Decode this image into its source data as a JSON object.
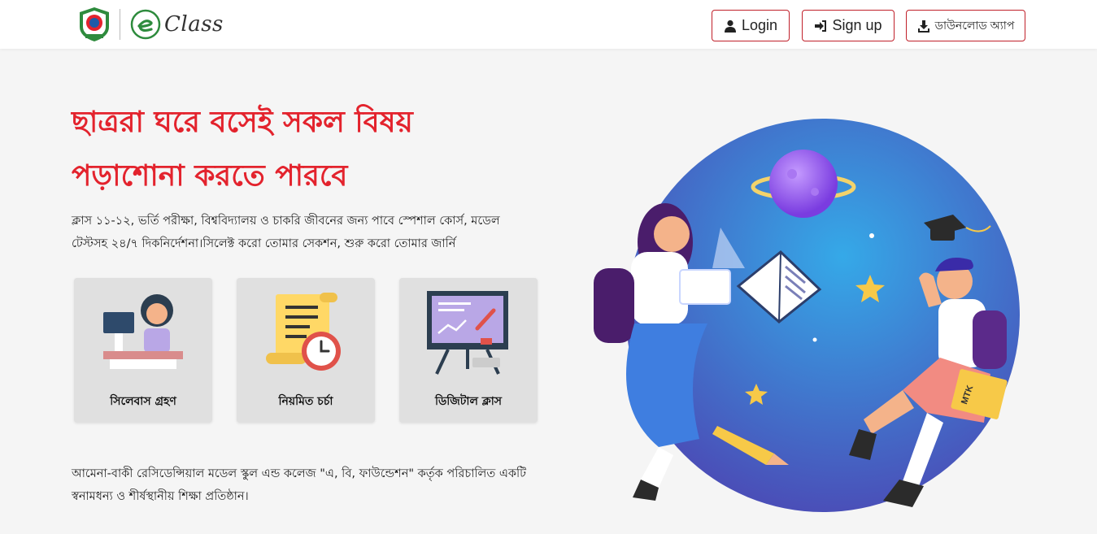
{
  "header": {
    "brand_suffix": "Class",
    "nav": {
      "login": "Login",
      "signup": "Sign up",
      "download": "ডাউনলোড অ্যাপ"
    }
  },
  "hero": {
    "title_line1": "ছাত্ররা ঘরে বসেই সকল বিষয়",
    "title_line2": "পড়াশোনা করতে পারবে",
    "description": "ক্লাস ১১-১২, ভর্তি পরীক্ষা, বিশ্ববিদ্যালয় ও চাকরি জীবনের জন্য পাবে স্পেশাল কোর্স, মডেল টেস্টসহ ২৪/৭ দিকনির্দেশনা।সিলেক্ট করো তোমার সেকশন, শুরু করো তোমার জার্নি"
  },
  "features": [
    {
      "label": "সিলেবাস গ্রহণ",
      "icon": "teacher-desk-icon"
    },
    {
      "label": "নিয়মিত চর্চা",
      "icon": "scroll-clock-icon"
    },
    {
      "label": "ডিজিটাল ক্লাস",
      "icon": "whiteboard-icon"
    }
  ],
  "footer_text": "আমেনা-বাকী রেসিডেন্সিয়াল মডেল স্কুল এন্ড কলেজ \"এ, বি, ফাউন্ডেশন\" কর্তৃক পরিচালিত একটি স্বনামধন্য ও শীর্ষস্থানীয় শিক্ষা প্রতিষ্ঠান।",
  "illustration": {
    "book_label": "MTK"
  },
  "colors": {
    "accent": "#e3232d",
    "button_border": "#c0202a",
    "brand_green": "#2e8b3d"
  }
}
